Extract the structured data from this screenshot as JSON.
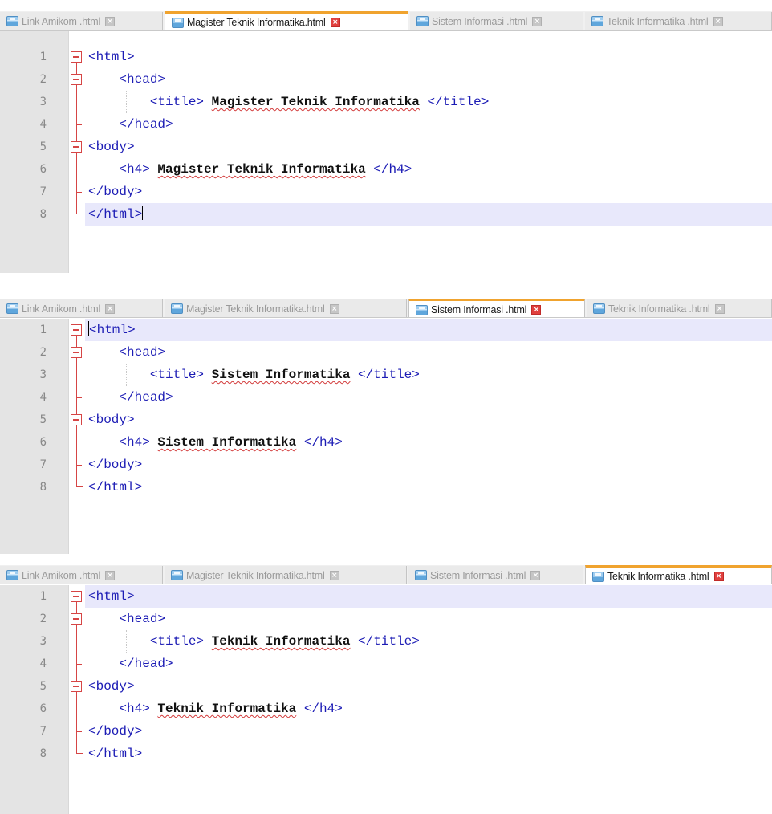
{
  "tabs": [
    {
      "label": "Link Amikom .html"
    },
    {
      "label": "Magister Teknik Informatika.html"
    },
    {
      "label": "Sistem Informasi .html"
    },
    {
      "label": "Teknik Informatika .html"
    }
  ],
  "close_glyph": "×",
  "panels": [
    {
      "active_tab": 1,
      "lines": [
        {
          "n": "1",
          "t1": "<html>"
        },
        {
          "n": "2",
          "t1": "    <head>"
        },
        {
          "n": "3",
          "t1": "        <title> ",
          "t2": "Magister Teknik Informatika",
          "t3": " </title>"
        },
        {
          "n": "4",
          "t1": "    </head>"
        },
        {
          "n": "5",
          "t1": "<body>"
        },
        {
          "n": "6",
          "t1": "    <h4> ",
          "t2": "Magister Teknik Informatika",
          "t3": " </h4>"
        },
        {
          "n": "7",
          "t1": "</body>"
        },
        {
          "n": "8",
          "t1": "</html>"
        }
      ]
    },
    {
      "active_tab": 2,
      "lines": [
        {
          "n": "1",
          "t1": "<html>"
        },
        {
          "n": "2",
          "t1": "    <head>"
        },
        {
          "n": "3",
          "t1": "        <title> ",
          "t2": "Sistem Informatika",
          "t3": " </title>"
        },
        {
          "n": "4",
          "t1": "    </head>"
        },
        {
          "n": "5",
          "t1": "<body>"
        },
        {
          "n": "6",
          "t1": "    <h4> ",
          "t2": "Sistem Informatika",
          "t3": " </h4>"
        },
        {
          "n": "7",
          "t1": "</body>"
        },
        {
          "n": "8",
          "t1": "</html>"
        }
      ]
    },
    {
      "active_tab": 3,
      "lines": [
        {
          "n": "1",
          "t1": "<html>"
        },
        {
          "n": "2",
          "t1": "    <head>"
        },
        {
          "n": "3",
          "t1": "        <title> ",
          "t2": "Teknik Informatika",
          "t3": " </title>"
        },
        {
          "n": "4",
          "t1": "    </head>"
        },
        {
          "n": "5",
          "t1": "<body>"
        },
        {
          "n": "6",
          "t1": "    <h4> ",
          "t2": "Teknik Informatika",
          "t3": " </h4>"
        },
        {
          "n": "7",
          "t1": "</body>"
        },
        {
          "n": "8",
          "t1": "</html>"
        }
      ]
    }
  ]
}
